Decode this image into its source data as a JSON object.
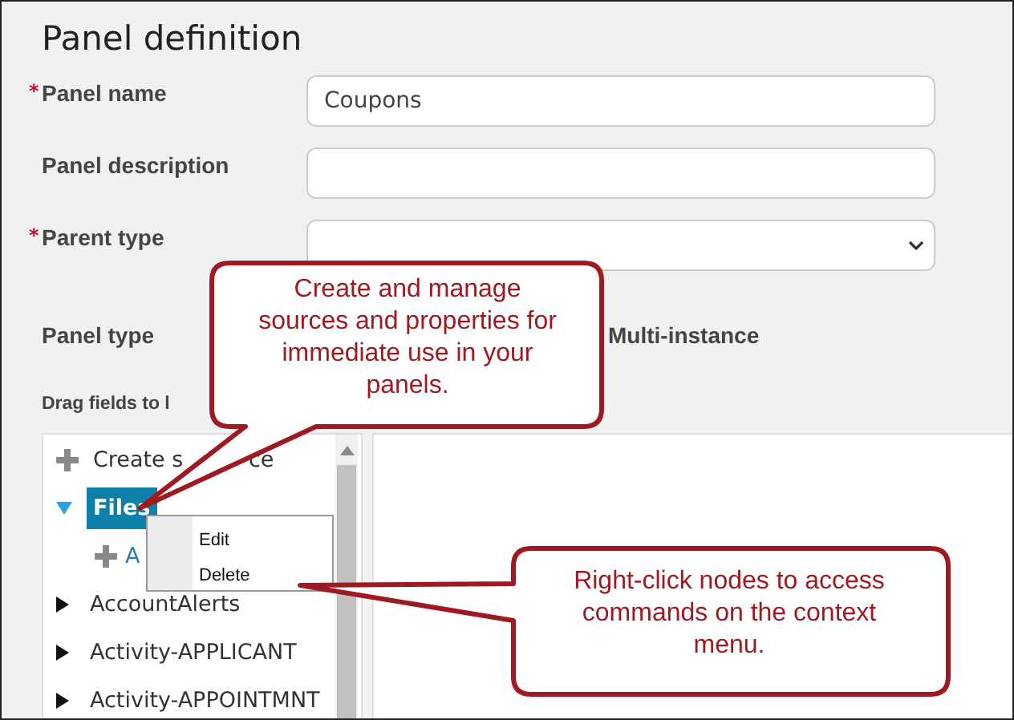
{
  "title": "Panel definition",
  "fields": [
    {
      "label": "Panel name",
      "required_mark": "*",
      "kind": "text",
      "value": "Coupons"
    },
    {
      "label": "Panel description",
      "kind": "text"
    },
    {
      "label": "Parent type",
      "required_mark": "*",
      "kind": "select"
    }
  ],
  "panel_type": {
    "label": "Panel type",
    "value": "Multi-instance"
  },
  "drag_label": "Drag fields to l",
  "tree": [
    {
      "kind": "action",
      "label": "Create s",
      "label_tail": "ce"
    },
    {
      "kind": "node",
      "label": "Files",
      "expanded": true,
      "selected": true,
      "children": [
        {
          "kind": "action",
          "label": "A"
        }
      ]
    },
    {
      "kind": "node",
      "label": "AccountAlerts",
      "expanded": false,
      "selected": false
    },
    {
      "kind": "node",
      "label": "Activity-APPLICANT",
      "expanded": false,
      "selected": false
    },
    {
      "kind": "node",
      "label": "Activity-APPOINTMNT",
      "expanded": false,
      "selected": false
    }
  ],
  "context_menu": [
    "Edit",
    "Delete"
  ],
  "callouts": [
    "Create and manage sources and properties for immediate use in your panels.",
    "Right-click nodes to access commands on the context menu."
  ]
}
